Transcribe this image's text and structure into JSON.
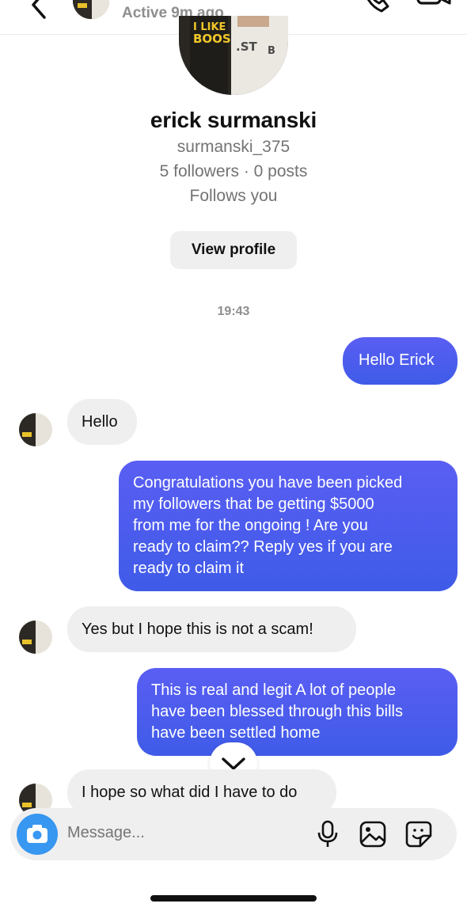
{
  "header": {
    "status": "Active 9m ago",
    "back_icon": "chevron-left-icon",
    "call_icon": "phone-icon",
    "video_icon": "video-camera-icon"
  },
  "profile": {
    "display_name": "erick surmanski",
    "username": "surmanski_375",
    "stats": "5 followers · 0 posts",
    "relationship": "Follows you",
    "view_profile_label": "View profile"
  },
  "conversation": {
    "timestamp": "19:43",
    "messages": [
      {
        "direction": "outgoing",
        "text": "Hello Erick"
      },
      {
        "direction": "incoming",
        "text": "Hello"
      },
      {
        "direction": "outgoing",
        "lines": [
          "Congratulations you have been picked",
          "my followers that be getting $5000",
          "from me for the ongoing ! Are you",
          "ready to claim?? Reply yes if you are",
          "ready to claim it"
        ]
      },
      {
        "direction": "incoming",
        "text": "Yes but I hope this is not a scam!"
      },
      {
        "direction": "outgoing",
        "lines": [
          "This is real and legit A lot of people",
          "have been blessed through this bills",
          "have been settled home"
        ]
      },
      {
        "direction": "incoming",
        "text": "I hope so what did I have to do"
      }
    ]
  },
  "composer": {
    "placeholder": "Message...",
    "icons": [
      "camera-icon",
      "microphone-icon",
      "gallery-icon",
      "sticker-icon"
    ]
  },
  "colors": {
    "outgoing_bubble": "#4a5cf0",
    "incoming_bubble": "#efefef",
    "camera_button": "#3897f0",
    "muted_text": "#737373"
  }
}
